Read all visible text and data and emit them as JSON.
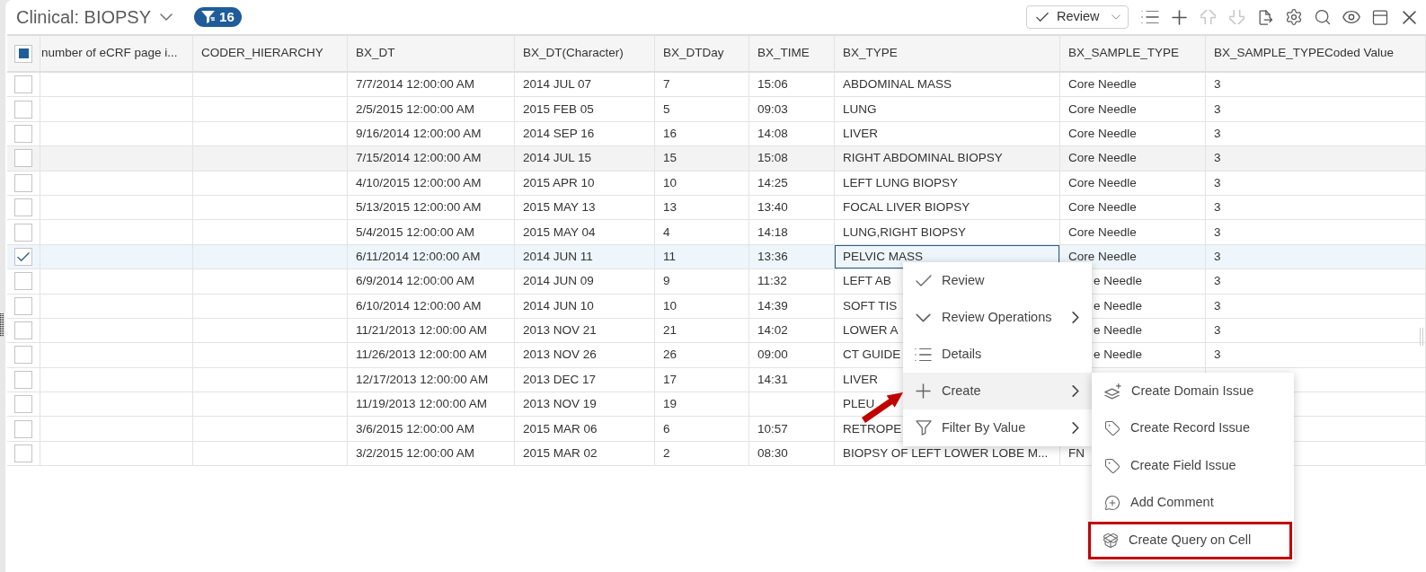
{
  "header": {
    "title": "Clinical: BIOPSY",
    "filter_count": "16"
  },
  "toolbar": {
    "review_label": "Review",
    "tools": [
      {
        "disabled": false
      },
      {
        "disabled": false
      },
      {
        "disabled": true
      },
      {
        "disabled": true
      },
      {
        "disabled": false
      },
      {
        "disabled": false
      },
      {
        "disabled": false
      },
      {
        "disabled": false
      },
      {
        "disabled": false
      },
      {
        "disabled": false
      }
    ]
  },
  "table": {
    "header_checkbox": {
      "partial": true
    },
    "columns": [
      "number of eCRF page i...",
      "CODER_HIERARCHY",
      "BX_DT",
      "BX_DT(Character)",
      "BX_DTDay",
      "BX_TIME",
      "BX_TYPE",
      "BX_SAMPLE_TYPE",
      "BX_SAMPLE_TYPECoded Value"
    ],
    "rows": [
      {
        "selected": false,
        "hovered": false,
        "bx_dt": "7/7/2014 12:00:00 AM",
        "bx_dt_character": "2014 JUL 07",
        "bx_dtday": "7",
        "bx_time": "15:06",
        "bx_type": "ABDOMINAL MASS",
        "bx_sample_type": "Core Needle",
        "bx_sample_type_coded_value": "3"
      },
      {
        "selected": false,
        "hovered": false,
        "bx_dt": "2/5/2015 12:00:00 AM",
        "bx_dt_character": "2015 FEB 05",
        "bx_dtday": "5",
        "bx_time": "09:03",
        "bx_type": "LUNG",
        "bx_sample_type": "Core Needle",
        "bx_sample_type_coded_value": "3"
      },
      {
        "selected": false,
        "hovered": false,
        "bx_dt": "9/16/2014 12:00:00 AM",
        "bx_dt_character": "2014 SEP 16",
        "bx_dtday": "16",
        "bx_time": "14:08",
        "bx_type": "LIVER",
        "bx_sample_type": "Core Needle",
        "bx_sample_type_coded_value": "3"
      },
      {
        "selected": false,
        "hovered": true,
        "bx_dt": "7/15/2014 12:00:00 AM",
        "bx_dt_character": "2014 JUL 15",
        "bx_dtday": "15",
        "bx_time": "15:08",
        "bx_type": "RIGHT ABDOMINAL BIOPSY",
        "bx_sample_type": "Core Needle",
        "bx_sample_type_coded_value": "3"
      },
      {
        "selected": false,
        "hovered": false,
        "bx_dt": "4/10/2015 12:00:00 AM",
        "bx_dt_character": "2015 APR 10",
        "bx_dtday": "10",
        "bx_time": "14:25",
        "bx_type": "LEFT LUNG BIOPSY",
        "bx_sample_type": "Core Needle",
        "bx_sample_type_coded_value": "3"
      },
      {
        "selected": false,
        "hovered": false,
        "bx_dt": "5/13/2015 12:00:00 AM",
        "bx_dt_character": "2015 MAY 13",
        "bx_dtday": "13",
        "bx_time": "13:40",
        "bx_type": "FOCAL LIVER BIOPSY",
        "bx_sample_type": "Core Needle",
        "bx_sample_type_coded_value": "3"
      },
      {
        "selected": false,
        "hovered": false,
        "bx_dt": "5/4/2015 12:00:00 AM",
        "bx_dt_character": "2015 MAY 04",
        "bx_dtday": "4",
        "bx_time": "14:18",
        "bx_type": "LUNG,RIGHT BIOPSY",
        "bx_sample_type": "Core Needle",
        "bx_sample_type_coded_value": "3"
      },
      {
        "selected": true,
        "hovered": false,
        "bx_dt": "6/11/2014 12:00:00 AM",
        "bx_dt_character": "2014 JUN 11",
        "bx_dtday": "11",
        "bx_time": "13:36",
        "bx_type": {
          "text": "PELVIC MASS",
          "focused": true
        },
        "bx_sample_type": "Core Needle",
        "bx_sample_type_coded_value": "3"
      },
      {
        "selected": false,
        "hovered": false,
        "bx_dt": "6/9/2014 12:00:00 AM",
        "bx_dt_character": "2014 JUN 09",
        "bx_dtday": "9",
        "bx_time": "11:32",
        "bx_type": "LEFT AB",
        "bx_sample_type": {
          "text": "e Needle",
          "covered": true
        },
        "bx_sample_type_coded_value": "3"
      },
      {
        "selected": false,
        "hovered": false,
        "bx_dt": "6/10/2014 12:00:00 AM",
        "bx_dt_character": "2014 JUN 10",
        "bx_dtday": "10",
        "bx_time": "14:39",
        "bx_type": "SOFT TIS",
        "bx_sample_type": {
          "text": "e Needle",
          "covered": true
        },
        "bx_sample_type_coded_value": "3"
      },
      {
        "selected": false,
        "hovered": false,
        "bx_dt": "11/21/2013 12:00:00 AM",
        "bx_dt_character": "2013 NOV 21",
        "bx_dtday": "21",
        "bx_time": "14:02",
        "bx_type": "LOWER A",
        "bx_sample_type": {
          "text": "e Needle",
          "covered": true
        },
        "bx_sample_type_coded_value": "3"
      },
      {
        "selected": false,
        "hovered": false,
        "bx_dt": "11/26/2013 12:00:00 AM",
        "bx_dt_character": "2013 NOV 26",
        "bx_dtday": "26",
        "bx_time": "09:00",
        "bx_type": "CT GUIDE",
        "bx_sample_type": {
          "text": "e Needle",
          "covered": true
        },
        "bx_sample_type_coded_value": "3"
      },
      {
        "selected": false,
        "hovered": false,
        "bx_dt": "12/17/2013 12:00:00 AM",
        "bx_dt_character": "2013 DEC 17",
        "bx_dtday": "17",
        "bx_time": "14:31",
        "bx_type": "LIVER"
      },
      {
        "selected": false,
        "hovered": false,
        "bx_dt": "11/19/2013 12:00:00 AM",
        "bx_dt_character": "2013 NOV 19",
        "bx_dtday": "19",
        "bx_type": "PLEU"
      },
      {
        "selected": false,
        "hovered": false,
        "bx_dt": "3/6/2015 12:00:00 AM",
        "bx_dt_character": "2015 MAR 06",
        "bx_dtday": "6",
        "bx_time": "10:57",
        "bx_type": "RETROPE"
      },
      {
        "selected": false,
        "hovered": false,
        "bx_dt": "3/2/2015 12:00:00 AM",
        "bx_dt_character": "2015 MAR 02",
        "bx_dtday": "2",
        "bx_time": "08:30",
        "bx_type": "BIOPSY OF LEFT LOWER LOBE M...",
        "bx_sample_type": "FN"
      }
    ]
  },
  "context_menu": {
    "items": [
      {
        "label": "Review",
        "submenu": false,
        "highlighted": false
      },
      {
        "label": "Review Operations",
        "submenu": true,
        "highlighted": false
      },
      {
        "label": "Details",
        "submenu": false,
        "highlighted": false
      },
      {
        "label": "Create",
        "submenu": true,
        "highlighted": true
      },
      {
        "label": "Filter By Value",
        "submenu": true,
        "highlighted": false
      }
    ]
  },
  "submenu": {
    "items": [
      {
        "label": "Create Domain Issue",
        "callout": false
      },
      {
        "label": "Create Record Issue",
        "callout": false
      },
      {
        "label": "Create Field Issue",
        "callout": false
      },
      {
        "label": "Add Comment",
        "callout": false
      },
      {
        "label": "Create Query on Cell",
        "callout": true
      }
    ]
  }
}
